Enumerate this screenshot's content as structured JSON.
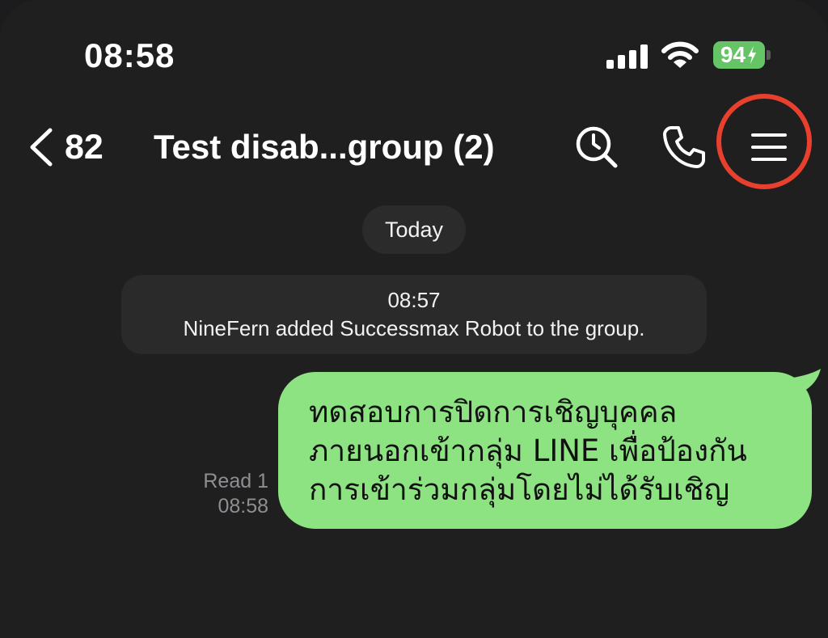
{
  "status_bar": {
    "time": "08:58",
    "battery_level": "94",
    "battery_state": "charging",
    "signal_bars": 4,
    "icons": [
      "cellular-signal-icon",
      "wifi-icon",
      "battery-charging-icon"
    ]
  },
  "header": {
    "back_count": "82",
    "title": "Test disab...group (2)",
    "actions": [
      "search-icon",
      "call-icon",
      "menu-icon"
    ]
  },
  "chat": {
    "date_separator": "Today",
    "system_message": {
      "time": "08:57",
      "text": "NineFern added Successmax Robot to the group."
    },
    "outgoing_message": {
      "read_status": "Read 1",
      "time": "08:58",
      "lines": [
        "ทดสอบการปิดการเชิญบุคคล",
        "ภายนอกเข้ากลุ่ม LINE เพื่อป้องกัน",
        "การเข้าร่วมกลุ่มโดยไม่ได้รับเชิญ"
      ]
    }
  },
  "colors": {
    "background": "#1f1f1f",
    "bubble": "#8de281",
    "battery": "#65c466",
    "highlight_circle": "#e8402d",
    "pill": "#2b2b2b"
  }
}
